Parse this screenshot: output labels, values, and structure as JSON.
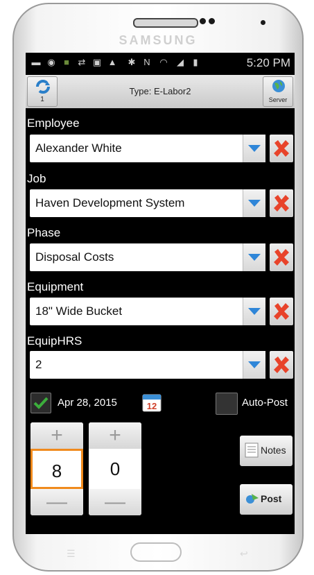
{
  "device": {
    "brand": "SAMSUNG"
  },
  "status_bar": {
    "time": "5:20 PM",
    "icons": [
      "message-icon",
      "location-icon",
      "photo-icon",
      "shuffle-icon",
      "calendar-icon",
      "warning-icon",
      "bluetooth-icon",
      "nfc-icon",
      "wifi-icon",
      "signal-icon",
      "battery-icon"
    ]
  },
  "toolbar": {
    "title": "Type: E-Labor2",
    "sync_count": "1",
    "server_label": "Server"
  },
  "fields": [
    {
      "label": "Employee",
      "value": "Alexander White"
    },
    {
      "label": "Job",
      "value": "Haven Development System"
    },
    {
      "label": "Phase",
      "value": "Disposal Costs"
    },
    {
      "label": "Equipment",
      "value": "18\" Wide Bucket"
    },
    {
      "label": "EquipHRS",
      "value": "2"
    }
  ],
  "date": {
    "checked": true,
    "value": "Apr 28, 2015",
    "calendar_day": "12"
  },
  "auto_post": {
    "label": "Auto-Post",
    "checked": false
  },
  "time_entry": {
    "hours": "8",
    "minutes": "0",
    "plus": "+",
    "minus": "—"
  },
  "actions": {
    "notes_label": "Notes",
    "post_label": "Post"
  },
  "colors": {
    "screen_bg": "#000000",
    "accent": "#3b8fd6",
    "clear_red": "#e8432a",
    "focus_orange": "#f08a1c",
    "check_green": "#3cae3c"
  }
}
